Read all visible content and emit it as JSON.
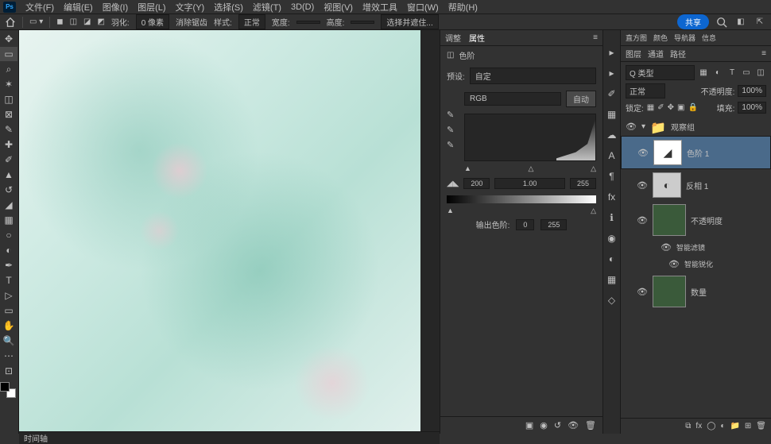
{
  "menu": {
    "logo": "Ps",
    "items": [
      "文件(F)",
      "编辑(E)",
      "图像(I)",
      "图层(L)",
      "文字(Y)",
      "选择(S)",
      "滤镜(T)",
      "3D(D)",
      "视图(V)",
      "增效工具",
      "窗口(W)",
      "帮助(H)"
    ]
  },
  "optbar": {
    "feather_label": "羽化:",
    "feather_value": "0 像素",
    "antialias": "消除锯齿",
    "style_label": "样式:",
    "style_value": "正常",
    "width_label": "宽度:",
    "height_label": "高度:",
    "refine": "选择并遮住...",
    "share": "共享"
  },
  "status": {
    "timeline": "时间轴"
  },
  "props": {
    "tabs": [
      "调整",
      "属性"
    ],
    "title": "色阶",
    "preset_label": "预设:",
    "preset_value": "自定",
    "channel": "RGB",
    "auto": "自动",
    "levels": {
      "black": "200",
      "mid": "1.00",
      "white": "255"
    },
    "output_label": "输出色阶:",
    "out_black": "0",
    "out_white": "255"
  },
  "layers_panel": {
    "top_tabs": [
      "直方图",
      "颜色",
      "导航器",
      "信息"
    ],
    "tabs": [
      "图层",
      "通道",
      "路径"
    ],
    "kind": "Q 类型",
    "blend": "正常",
    "opacity_label": "不透明度:",
    "opacity": "100%",
    "lock_label": "锁定:",
    "fill_label": "填充:",
    "fill": "100%",
    "items": [
      {
        "name": "观察组",
        "type": "group"
      },
      {
        "name": "色阶 1",
        "type": "adjust",
        "selected": true
      },
      {
        "name": "反相 1",
        "type": "adjust2"
      },
      {
        "name": "不透明度",
        "type": "image",
        "smart": true,
        "filter": "智能滤镜",
        "subfilter": "智能锐化"
      },
      {
        "name": "数量",
        "type": "image"
      }
    ]
  },
  "chart_data": {
    "type": "histogram",
    "title": "色阶",
    "channel": "RGB",
    "input_range": [
      0,
      255
    ],
    "input_black": 200,
    "input_mid": 1.0,
    "input_white": 255,
    "output_black": 0,
    "output_white": 255
  }
}
